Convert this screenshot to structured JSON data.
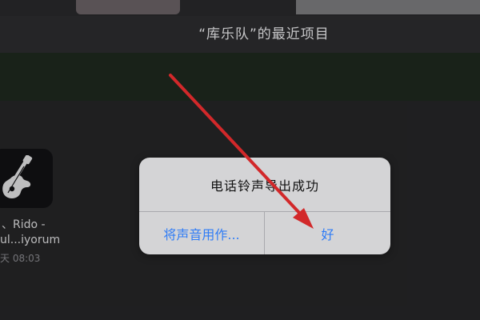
{
  "header": {
    "title": "“库乐队”的最近项目"
  },
  "recent_item": {
    "name_line1": "、Rido -",
    "name_line2": "ul...iyorum",
    "date": "天 08:03",
    "icon": "guitar-icon"
  },
  "alert": {
    "title": "电话铃声导出成功",
    "left_button": "将声音用作...",
    "right_button": "好"
  },
  "colors": {
    "alert_button": "#2f7cf6",
    "annotation_arrow": "#d2282a"
  }
}
